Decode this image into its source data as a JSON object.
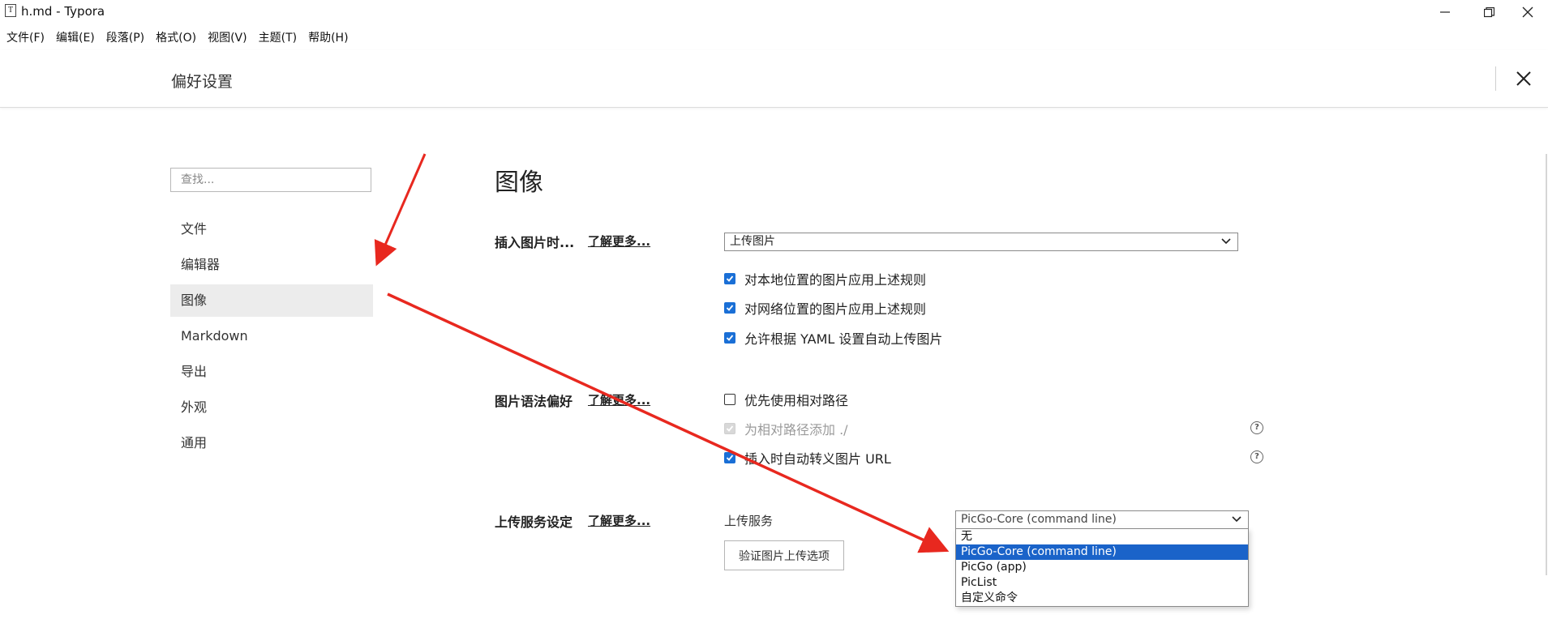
{
  "window": {
    "app_icon_glyph": "T",
    "title": "h.md - Typora"
  },
  "menu": [
    {
      "label": "文件(F)"
    },
    {
      "label": "编辑(E)"
    },
    {
      "label": "段落(P)"
    },
    {
      "label": "格式(O)"
    },
    {
      "label": "视图(V)"
    },
    {
      "label": "主题(T)"
    },
    {
      "label": "帮助(H)"
    }
  ],
  "preferences": {
    "title": "偏好设置"
  },
  "sidebar": {
    "search_placeholder": "查找...",
    "items": [
      {
        "label": "文件"
      },
      {
        "label": "编辑器"
      },
      {
        "label": "图像"
      },
      {
        "label": "Markdown"
      },
      {
        "label": "导出"
      },
      {
        "label": "外观"
      },
      {
        "label": "通用"
      }
    ],
    "active_index": 2
  },
  "content": {
    "section_title": "图像",
    "learn_more": "了解更多...",
    "insert": {
      "label": "插入图片时...",
      "select_value": "上传图片",
      "options": [
        {
          "label": "对本地位置的图片应用上述规则",
          "checked": true
        },
        {
          "label": "对网络位置的图片应用上述规则",
          "checked": true
        },
        {
          "label": "允许根据 YAML 设置自动上传图片",
          "checked": true
        }
      ]
    },
    "syntax": {
      "label": "图片语法偏好",
      "options": [
        {
          "label": "优先使用相对路径",
          "checked": false
        },
        {
          "label": "为相对路径添加 ./",
          "checked": true,
          "disabled": true
        },
        {
          "label": "插入时自动转义图片 URL",
          "checked": true
        }
      ],
      "help_glyph": "?"
    },
    "upload": {
      "label": "上传服务设定",
      "service_label": "上传服务",
      "service_value": "PicGo-Core (command line)",
      "service_options": [
        "无",
        "PicGo-Core (command line)",
        "PicGo (app)",
        "PicList",
        "自定义命令"
      ],
      "selected_index": 1,
      "verify_button": "验证图片上传选项"
    }
  },
  "colors": {
    "accent_blue": "#1a6fd6",
    "selection_blue": "#1a63c9",
    "annotation_red": "#e8281f"
  }
}
